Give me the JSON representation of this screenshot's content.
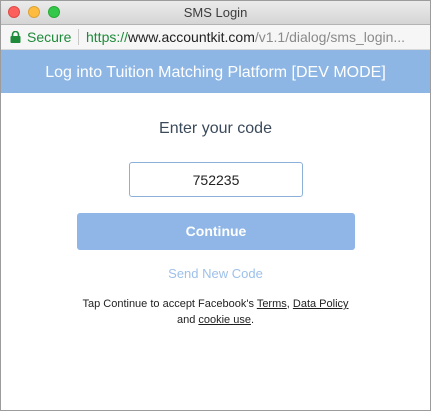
{
  "window": {
    "title": "SMS Login"
  },
  "address_bar": {
    "secure_label": "Secure",
    "url_scheme": "https://",
    "url_host": "www.accountkit.com",
    "url_path": "/v1.1/dialog/sms_login..."
  },
  "header": {
    "title": "Log into Tuition Matching Platform [DEV MODE]",
    "color": "#8db6e4"
  },
  "main": {
    "heading": "Enter your code",
    "code_value": "752235",
    "continue_label": "Continue",
    "resend_label": "Send New Code"
  },
  "legal": {
    "prefix": "Tap Continue to accept Facebook's",
    "terms": "Terms",
    "comma": ",",
    "data_policy": "Data Policy",
    "and": "and",
    "cookie_use": "cookie use",
    "period": "."
  },
  "colors": {
    "secure_green": "#1e8a3a",
    "button_blue": "#8fb6e6",
    "link_blue": "#9ec0ea"
  },
  "icons": {
    "lock": "lock-icon",
    "close": "close-window-icon",
    "minimize": "minimize-window-icon",
    "maximize": "maximize-window-icon"
  }
}
